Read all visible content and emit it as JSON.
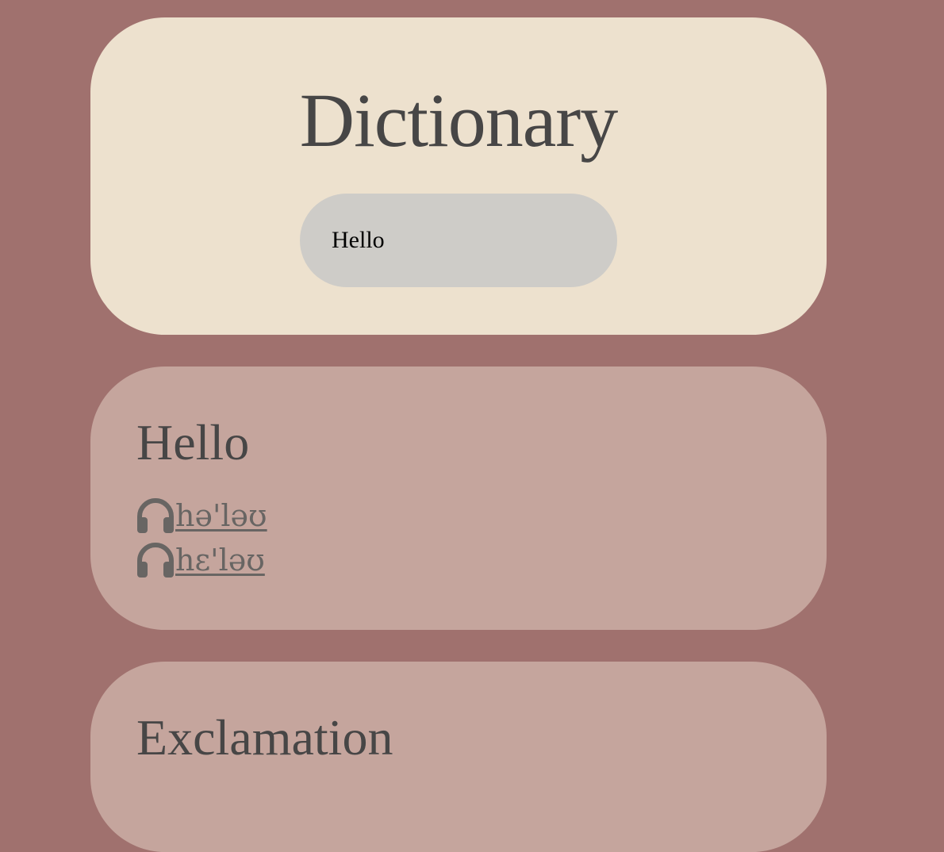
{
  "app": {
    "title": "Dictionary"
  },
  "search": {
    "value": "Hello"
  },
  "entry": {
    "word": "Hello",
    "pronunciations": [
      {
        "icon": "headphones-icon",
        "text": "hə'ləʊ"
      },
      {
        "icon": "headphones-icon",
        "text": "hɛ'ləʊ"
      }
    ]
  },
  "meanings": [
    {
      "part_of_speech": "Exclamation"
    }
  ],
  "colors": {
    "page_background": "#a0716e",
    "search_card": "#ede1ce",
    "search_input": "#ceccc8",
    "result_card": "#c5a59d",
    "heading_text": "#474646",
    "pronunciation_text": "#686563"
  }
}
